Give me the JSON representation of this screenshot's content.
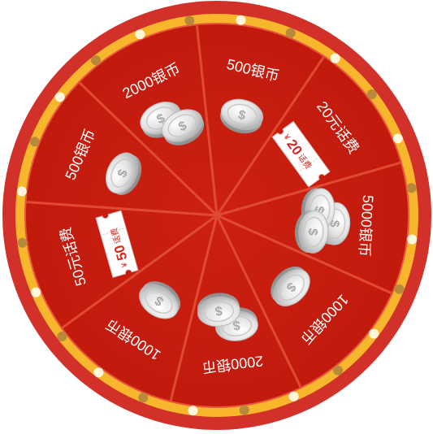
{
  "wheel": {
    "segments": [
      {
        "label": "500银币",
        "prize": "coins",
        "stack": 1
      },
      {
        "label": "2000银币",
        "prize": "coins",
        "stack": 2
      },
      {
        "label": "500银币",
        "prize": "coins",
        "stack": 1
      },
      {
        "label": "20元话费",
        "prize": "ticket",
        "ticket_currency": "¥",
        "ticket_amount": "20",
        "ticket_unit": "话费"
      },
      {
        "label": "5000银币",
        "prize": "coins",
        "stack": 3
      },
      {
        "label": "1000银币",
        "prize": "coins",
        "stack": 1
      },
      {
        "label": "2000银币",
        "prize": "coins",
        "stack": 2
      },
      {
        "label": "1000银币",
        "prize": "coins",
        "stack": 1
      },
      {
        "label": "50元话费",
        "prize": "ticket",
        "ticket_currency": "¥",
        "ticket_amount": "50",
        "ticket_unit": "话费"
      }
    ],
    "coin_symbol": "$",
    "colors": {
      "outer_ring": "#d2312a",
      "gold_band": "#f7b62b",
      "face": "#c81d0f",
      "divider": "#e04a32",
      "bulb_light": "#fff6dc",
      "bulb_dark": "#b8893b"
    }
  }
}
